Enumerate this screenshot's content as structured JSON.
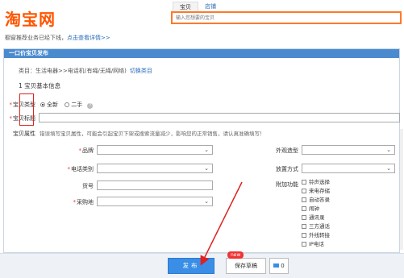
{
  "header": {
    "logo": "淘宝网",
    "search_tabs": [
      "宝贝",
      "店铺"
    ],
    "search_placeholder": "输入您想要的宝贝"
  },
  "notice": {
    "text": "橱窗推荐业务已经下线，",
    "link": "点击查看详情>>"
  },
  "panel": {
    "title": "一口价宝贝发布",
    "category_prefix": "类目：生活电器>>电话机(有绳/无绳/网络)",
    "category_link": "切换类目",
    "section_title": "1  宝贝基本信息",
    "type_label": "宝贝类型",
    "type_options": [
      "全新",
      "二手"
    ],
    "title_label": "宝贝标题",
    "attr_label": "宝贝属性",
    "attr_tip": "错误填写宝贝属性，可能会引起宝贝下架或搜索流量减少，影响您的正常销售，请认真准确填写！",
    "left_fields": [
      {
        "label": "品牌",
        "required": true,
        "kind": "select"
      },
      {
        "label": "电话类别",
        "required": true,
        "kind": "select"
      },
      {
        "label": "货号",
        "required": false,
        "kind": "input"
      },
      {
        "label": "采购地",
        "required": true,
        "kind": "select"
      }
    ],
    "right_fields": [
      {
        "label": "外观造型",
        "kind": "select"
      },
      {
        "label": "放置方式",
        "kind": "select"
      }
    ],
    "extra_label": "附加功能",
    "extra_options": [
      "铃声选择",
      "来电存储",
      "自动答录",
      "闹钟",
      "通讯录",
      "三方通话",
      "外线转接",
      "IP电话"
    ]
  },
  "footer": {
    "publish": "发布",
    "draft": "保存草稿",
    "new_badge": "new",
    "msg_count": "0"
  },
  "colors": {
    "brand": "#ff5500",
    "panel_head": "#4a8bd0",
    "publish": "#3a8ee6",
    "annotation": "#dd2222"
  }
}
